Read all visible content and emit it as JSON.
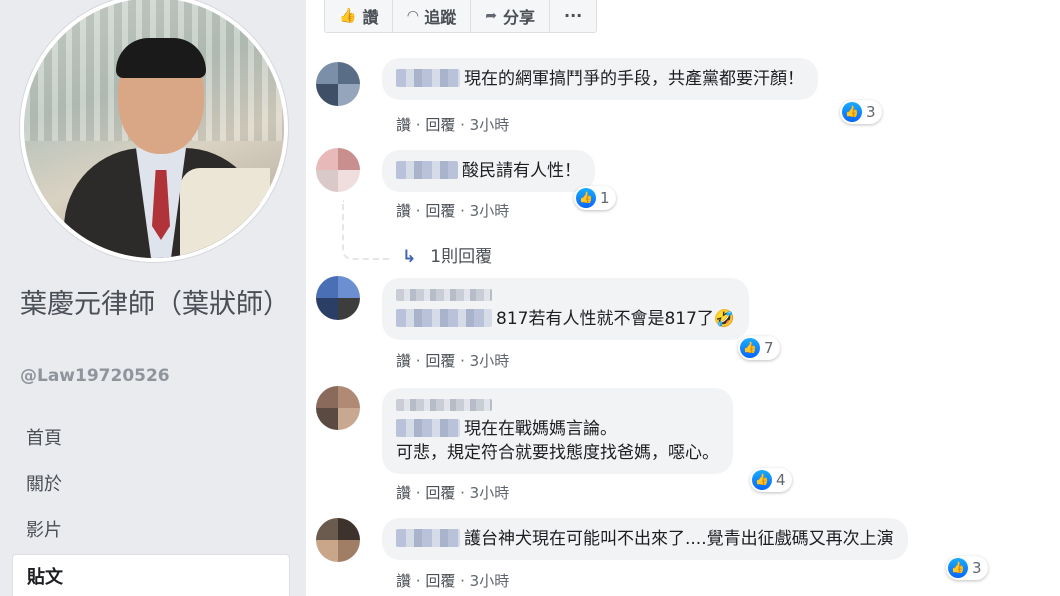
{
  "sidebar": {
    "page_name": "葉慶元律師（葉狀師）",
    "handle": "@Law19720526",
    "nav": [
      {
        "label": "首頁"
      },
      {
        "label": "關於"
      },
      {
        "label": "影片"
      },
      {
        "label": "貼文"
      }
    ]
  },
  "actionbar": {
    "like": "讚",
    "follow": "追蹤",
    "share": "分享",
    "more": "···"
  },
  "comments": [
    {
      "text": "現在的網軍搞鬥爭的手段，共產黨都要汗顏！",
      "like": "讚",
      "reply": "回覆",
      "time": "3小時",
      "reactions": "3"
    },
    {
      "text": "酸民請有人性！",
      "like": "讚",
      "reply": "回覆",
      "time": "3小時",
      "reactions": "1",
      "replies": "1則回覆"
    },
    {
      "text": "817若有人性就不會是817了🤣",
      "like": "讚",
      "reply": "回覆",
      "time": "3小時",
      "reactions": "7"
    },
    {
      "text1": "現在在戰媽媽言論。",
      "text2": "可悲，規定符合就要找態度找爸媽，噁心。",
      "like": "讚",
      "reply": "回覆",
      "time": "3小時",
      "reactions": "4"
    },
    {
      "text": "護台神犬現在可能叫不出來了....覺青出征戲碼又再次上演",
      "like": "讚",
      "reply": "回覆",
      "time": "3小時",
      "reactions": "3"
    }
  ],
  "colors": {
    "accent": "#4267b2",
    "like_blue": "#0866ff",
    "sidebar_bg": "#e9ebee",
    "bubble_bg": "#f2f3f5"
  }
}
